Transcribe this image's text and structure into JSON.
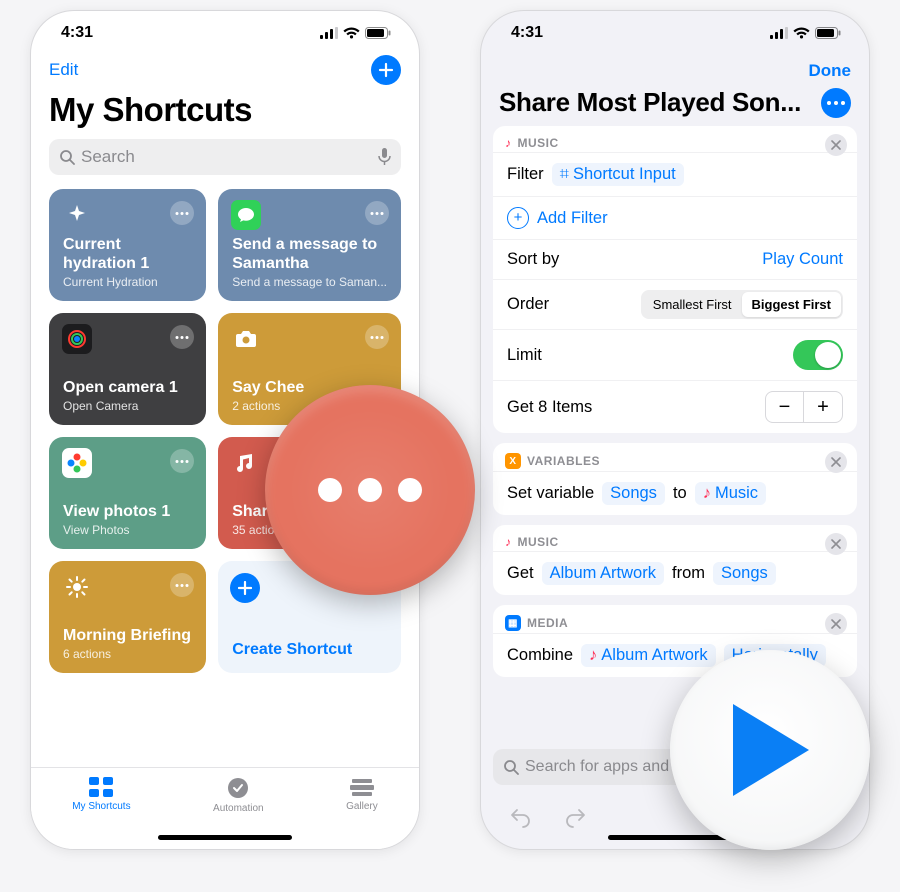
{
  "status": {
    "time": "4:31",
    "location_arrow": true
  },
  "colors": {
    "accent": "#007aff",
    "green": "#34c759",
    "callout_red": "#e57360"
  },
  "screen1": {
    "edit": "Edit",
    "title": "My Shortcuts",
    "search_placeholder": "Search",
    "cards": [
      {
        "title": "Current hydration 1",
        "subtitle": "Current Hydration",
        "color": "#6e8bae",
        "icon": "sparkle"
      },
      {
        "title": "Send a message to Samantha",
        "subtitle": "Send a message to Saman...",
        "color": "#6e8bae",
        "icon": "messages"
      },
      {
        "title": "Open camera 1",
        "subtitle": "Open Camera",
        "color": "#3f3f41",
        "icon": "camera-color"
      },
      {
        "title": "Say Chee",
        "subtitle": "2 actions",
        "color": "#cd9b39",
        "icon": "camera"
      },
      {
        "title": "View photos 1",
        "subtitle": "View Photos",
        "color": "#5d9e87",
        "icon": "photos"
      },
      {
        "title": "Share Songs",
        "subtitle": "35 actions",
        "color": "#d25b4e",
        "icon": "music"
      },
      {
        "title": "Morning Briefing",
        "subtitle": "6 actions",
        "color": "#cd9b39",
        "icon": "sun"
      }
    ],
    "create_label": "Create Shortcut",
    "tabs": [
      {
        "label": "My Shortcuts",
        "active": true
      },
      {
        "label": "Automation",
        "active": false
      },
      {
        "label": "Gallery",
        "active": false
      }
    ]
  },
  "screen2": {
    "done": "Done",
    "title": "Share Most Played Son...",
    "music": {
      "header": "MUSIC",
      "filter_label": "Filter",
      "filter_token": "Shortcut Input",
      "add_filter": "Add Filter",
      "sort_by_label": "Sort by",
      "sort_by_value": "Play Count",
      "order_label": "Order",
      "order_options": [
        "Smallest First",
        "Biggest First"
      ],
      "order_selected": "Biggest First",
      "limit_label": "Limit",
      "limit_on": true,
      "get_items_label": "Get 8 Items"
    },
    "variables": {
      "header": "VARIABLES",
      "text_a": "Set variable",
      "var_name": "Songs",
      "text_b": "to",
      "var_value": "Music"
    },
    "music2": {
      "header": "MUSIC",
      "text_a": "Get",
      "token_a": "Album Artwork",
      "text_b": "from",
      "token_b": "Songs"
    },
    "media": {
      "header": "MEDIA",
      "text_a": "Combine",
      "token_a": "Album Artwork",
      "token_b": "Horizontally"
    },
    "search_placeholder": "Search for apps and actions"
  }
}
